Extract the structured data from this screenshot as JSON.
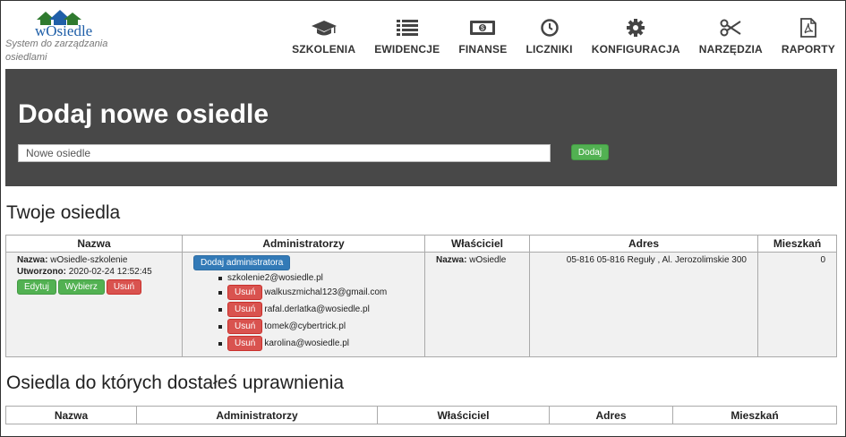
{
  "brand": {
    "name": "wOsiedle",
    "tagline": "System do zarządzania osiedlami"
  },
  "nav": [
    {
      "label": "SZKOLENIA",
      "icon": "graduation-cap-icon"
    },
    {
      "label": "EWIDENCJE",
      "icon": "list-icon"
    },
    {
      "label": "FINANSE",
      "icon": "money-icon"
    },
    {
      "label": "LICZNIKI",
      "icon": "clock-icon"
    },
    {
      "label": "KONFIGURACJA",
      "icon": "gear-icon"
    },
    {
      "label": "NARZĘDZIA",
      "icon": "scissors-icon"
    },
    {
      "label": "RAPORTY",
      "icon": "pdf-file-icon"
    }
  ],
  "hero": {
    "title": "Dodaj nowe osiedle",
    "input_value": "Nowe osiedle",
    "add_label": "Dodaj"
  },
  "your_section": {
    "title": "Twoje osiedla",
    "headers": [
      "Nazwa",
      "Administratorzy",
      "Właściciel",
      "Adres",
      "Mieszkań"
    ],
    "row": {
      "name_label": "Nazwa:",
      "name_value": "wOsiedle-szkolenie",
      "created_label": "Utworzono:",
      "created_value": "2020-02-24 12:52:45",
      "edit_label": "Edytuj",
      "choose_label": "Wybierz",
      "delete_label": "Usuń",
      "add_admin_label": "Dodaj administratora",
      "admins": [
        {
          "email": "szkolenie2@wosiedle.pl",
          "removable": false
        },
        {
          "email": "walkuszmichal123@gmail.com",
          "removable": true
        },
        {
          "email": "rafal.derlatka@wosiedle.pl",
          "removable": true
        },
        {
          "email": "tomek@cybertrick.pl",
          "removable": true
        },
        {
          "email": "karolina@wosiedle.pl",
          "removable": true
        }
      ],
      "remove_label": "Usuń",
      "owner_label": "Nazwa:",
      "owner_value": "wOsiedle",
      "address": "05-816 05-816 Reguły , Al. Jerozolimskie 300",
      "flats": "0"
    }
  },
  "shared_section": {
    "title": "Osiedla do których dostałeś uprawnienia",
    "headers": [
      "Nazwa",
      "Administratorzy",
      "Właściciel",
      "Adres",
      "Mieszkań"
    ]
  },
  "colors": {
    "hero_bg": "#484848",
    "green": "#52b152",
    "red": "#d9534f",
    "blue": "#337ab7",
    "brand_blue": "#1f5fa8"
  }
}
